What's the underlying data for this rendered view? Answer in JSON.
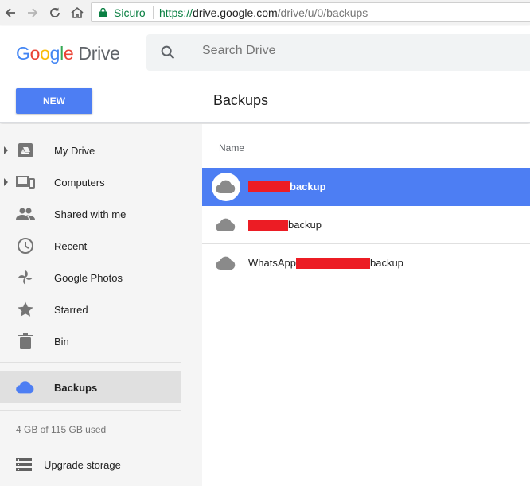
{
  "browser": {
    "security_label": "Sicuro",
    "url_scheme": "https://",
    "url_host": "drive.google.com",
    "url_path": "/drive/u/0/backups"
  },
  "app": {
    "logo_letters": [
      "G",
      "o",
      "o",
      "g",
      "l",
      "e"
    ],
    "logo_product": "Drive",
    "search_placeholder": "Search Drive",
    "new_button": "NEW",
    "page_title": "Backups"
  },
  "sidebar": {
    "items": [
      {
        "label": "My Drive",
        "icon": "my-drive-icon",
        "expandable": true
      },
      {
        "label": "Computers",
        "icon": "computers-icon",
        "expandable": true
      },
      {
        "label": "Shared with me",
        "icon": "shared-with-me-icon",
        "expandable": false
      },
      {
        "label": "Recent",
        "icon": "clock-icon",
        "expandable": false
      },
      {
        "label": "Google Photos",
        "icon": "pinwheel-icon",
        "expandable": false
      },
      {
        "label": "Starred",
        "icon": "star-icon",
        "expandable": false
      },
      {
        "label": "Bin",
        "icon": "trash-icon",
        "expandable": false
      }
    ],
    "active_item": {
      "label": "Backups",
      "icon": "cloud-icon"
    },
    "storage_text": "4 GB of 115 GB used",
    "upgrade_label": "Upgrade storage"
  },
  "list": {
    "column_header": "Name",
    "rows": [
      {
        "prefix": "",
        "suffix": "backup",
        "selected": true
      },
      {
        "prefix": "",
        "suffix": "backup",
        "selected": false
      },
      {
        "prefix": "WhatsApp",
        "suffix": "backup",
        "selected": false
      }
    ]
  },
  "colors": {
    "accent": "#4d7ef3",
    "secure_green": "#0b8043",
    "redaction": "#ec1c24"
  }
}
